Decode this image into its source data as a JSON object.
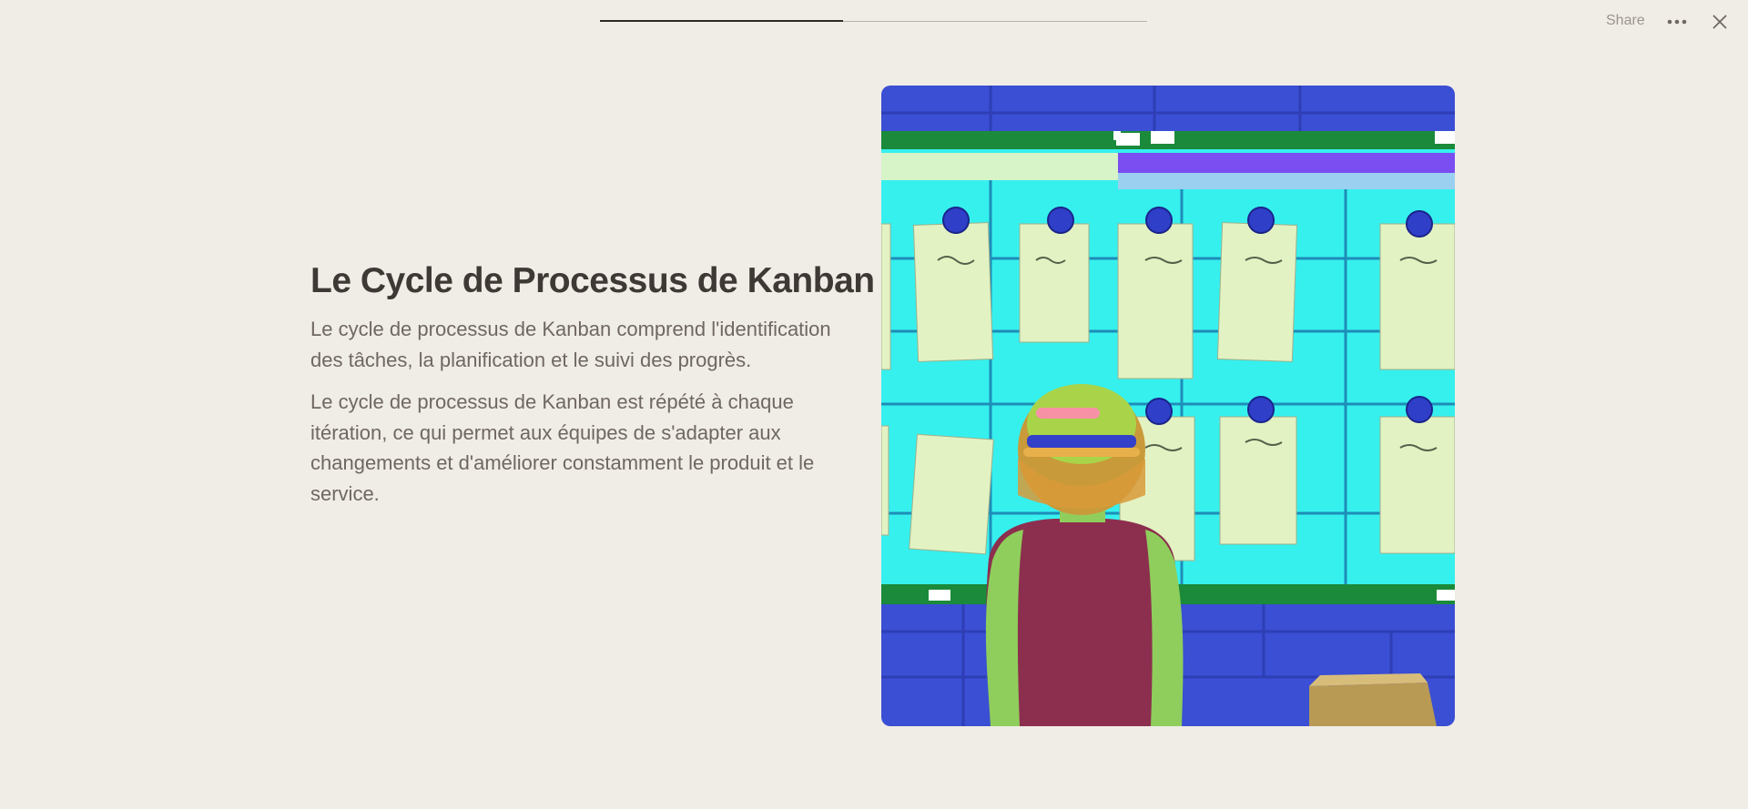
{
  "progress": {
    "fraction": 0.445
  },
  "toolbar": {
    "share_label": "Share",
    "more_icon": "more-horizontal-icon",
    "close_icon": "close-icon"
  },
  "slide": {
    "title": "Le Cycle de Processus de Kanban",
    "paragraphs": [
      "Le cycle de processus de Kanban comprend l'identification des tâches, la planification et le suivi des progrès.",
      "Le cycle de processus de Kanban est répété à chaque itération, ce qui permet aux équipes de s'adapter aux changements et d'améliorer constamment le produit et le service."
    ]
  },
  "colors": {
    "background": "#f0ece6",
    "title": "#3e3935",
    "body_text": "#6f6861",
    "progress_fill": "#2e2b28",
    "progress_track": "#b9b3ab",
    "toolbar_text": "#9b958e"
  }
}
